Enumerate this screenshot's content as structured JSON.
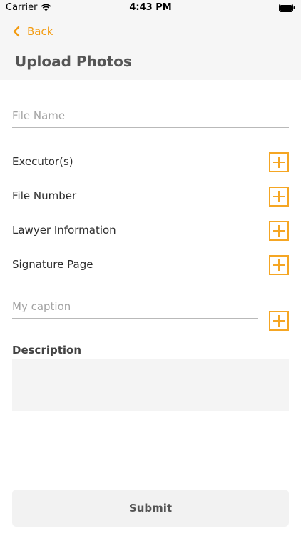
{
  "status_bar": {
    "carrier": "Carrier",
    "time": "4:43 PM"
  },
  "nav": {
    "back_label": "Back"
  },
  "page": {
    "title": "Upload Photos"
  },
  "form": {
    "file_name_placeholder": "File Name",
    "file_name_value": "",
    "rows": [
      {
        "label": "Executor(s)"
      },
      {
        "label": "File Number"
      },
      {
        "label": "Lawyer Information"
      },
      {
        "label": "Signature Page"
      }
    ],
    "caption_placeholder": "My caption",
    "caption_value": "",
    "description_label": "Description",
    "description_value": "",
    "submit_label": "Submit"
  },
  "colors": {
    "accent": "#f5a623",
    "back_link": "#f39c12",
    "header_bg": "#f6f6f6",
    "input_bg": "#f4f4f4"
  },
  "icons": {
    "back": "chevron-left-icon",
    "add": "plus-square-icon",
    "signal": "wifi-icon",
    "battery": "battery-icon"
  }
}
